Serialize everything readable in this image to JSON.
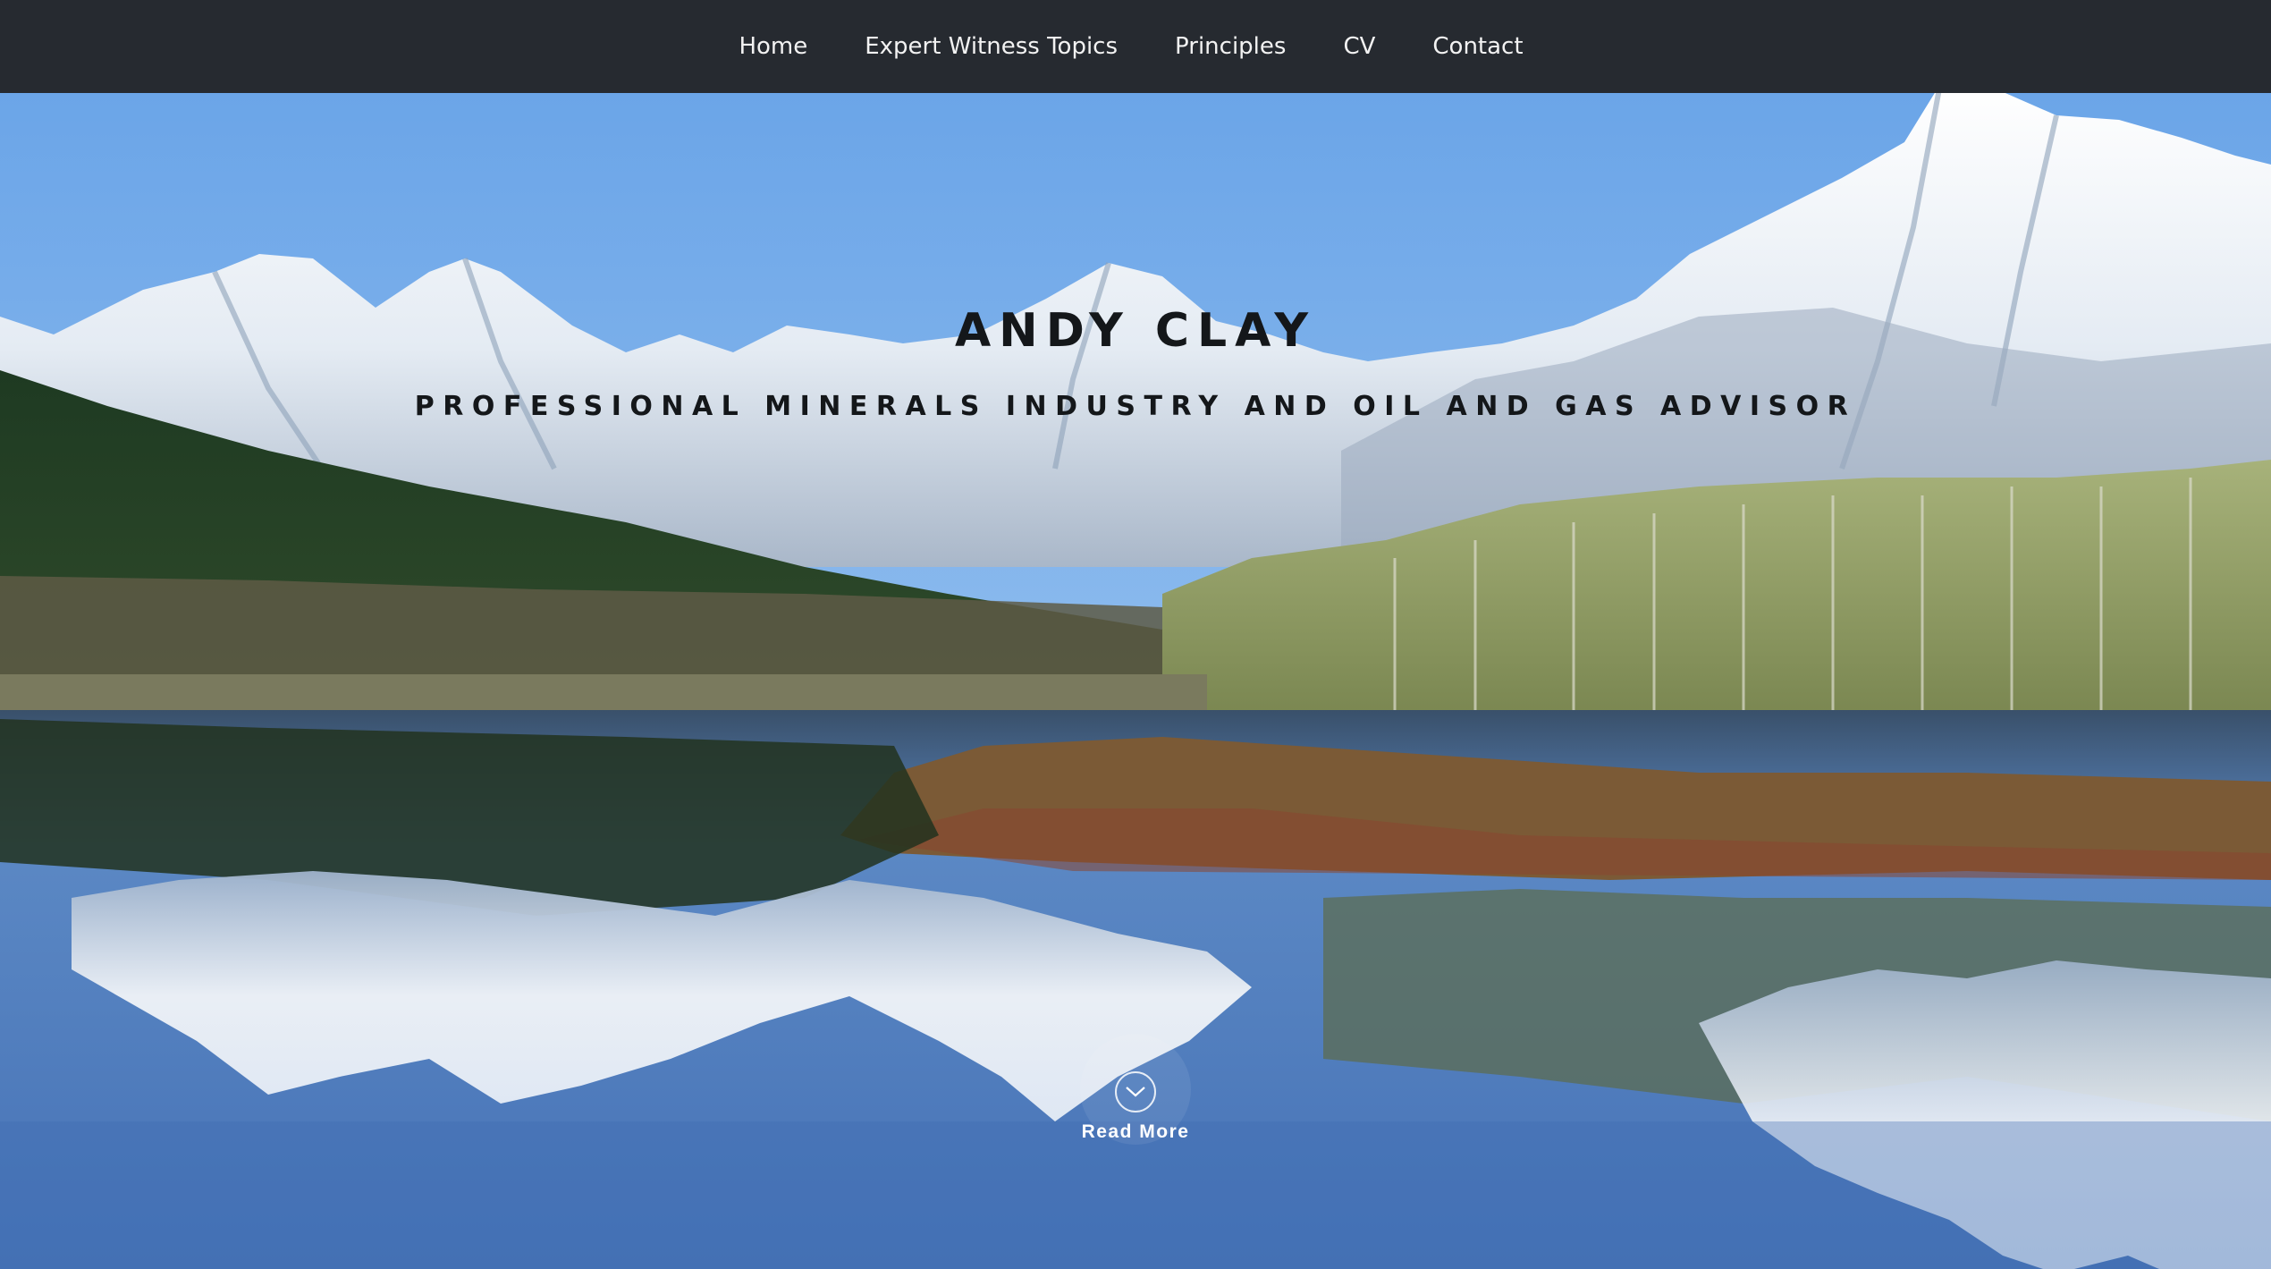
{
  "nav": {
    "items": [
      {
        "label": "Home"
      },
      {
        "label": "Expert Witness Topics"
      },
      {
        "label": "Principles"
      },
      {
        "label": "CV"
      },
      {
        "label": "Contact"
      }
    ]
  },
  "hero": {
    "title": "ANDY CLAY",
    "subtitle": "PROFESSIONAL MINERALS INDUSTRY AND OIL AND GAS ADVISOR",
    "read_more_label": "Read More",
    "read_more_icon": "chevron-down-icon",
    "background_image": "snow-capped mountains reflected in a lake"
  },
  "colors": {
    "nav_background": "#262a30",
    "nav_text": "#f2f2f2",
    "hero_text": "#14171a",
    "sky": "#6aa3e6",
    "lake": "#4d7fc4"
  }
}
